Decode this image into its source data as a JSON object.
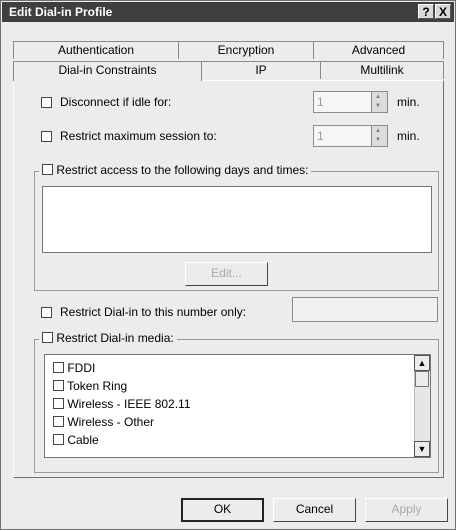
{
  "window": {
    "title": "Edit Dial-in Profile",
    "help_button": "?",
    "close_button": "X"
  },
  "tabs": {
    "row1": [
      "Authentication",
      "Encryption",
      "Advanced"
    ],
    "row2": [
      "Dial-in Constraints",
      "IP",
      "Multilink"
    ],
    "active": "Dial-in Constraints"
  },
  "constraints": {
    "disconnect_idle": {
      "label": "Disconnect if idle for:",
      "value": "1",
      "unit": "min.",
      "checked": false
    },
    "restrict_session": {
      "label": "Restrict maximum session to:",
      "value": "1",
      "unit": "min.",
      "checked": false
    },
    "restrict_times": {
      "label": "Restrict access to the following days and times:",
      "checked": false,
      "edit_button": "Edit..."
    },
    "restrict_number": {
      "label": "Restrict Dial-in to this number only:",
      "value": "",
      "checked": false
    },
    "restrict_media": {
      "label": "Restrict Dial-in media:",
      "checked": false,
      "items": [
        "FDDI",
        "Token Ring",
        "Wireless - IEEE 802.11",
        "Wireless - Other",
        "Cable"
      ]
    }
  },
  "buttons": {
    "ok": "OK",
    "cancel": "Cancel",
    "apply": "Apply"
  }
}
